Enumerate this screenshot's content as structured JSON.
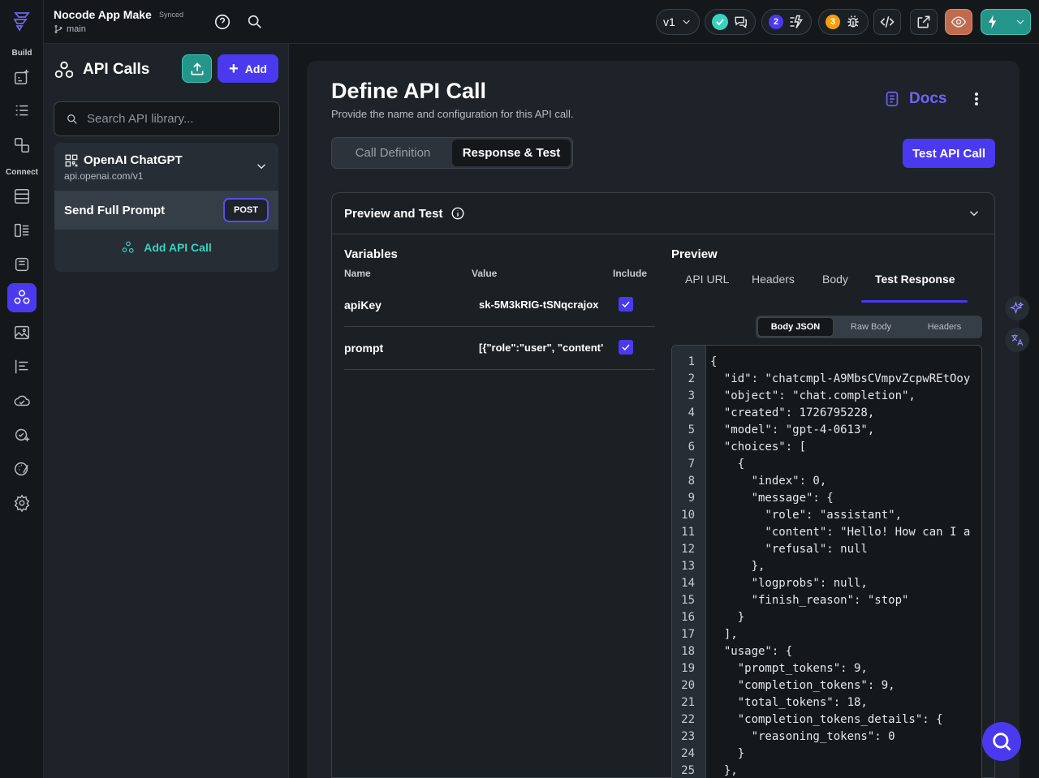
{
  "project": {
    "name": "Nocode App Make",
    "sync_status": "Synced",
    "branch": "main"
  },
  "topbar": {
    "version": "v1",
    "notifications": {
      "warnings_count": "2",
      "bugs_count": "3"
    },
    "colors": {
      "accent": "#4b39ef",
      "success": "#39d2c0",
      "warning": "#f59e0b"
    }
  },
  "rail": {
    "build_label": "Build",
    "connect_label": "Connect"
  },
  "api_panel": {
    "title": "API Calls",
    "add_label": "Add",
    "search_placeholder": "Search API library...",
    "group": {
      "name": "OpenAI ChatGPT",
      "base_url": "api.openai.com/v1"
    },
    "calls": [
      {
        "name": "Send Full Prompt",
        "method": "POST"
      }
    ],
    "add_call_label": "Add API Call"
  },
  "main": {
    "title": "Define API Call",
    "subtitle": "Provide the name and configuration for this API call.",
    "docs_label": "Docs",
    "tabs": [
      "Call Definition",
      "Response & Test"
    ],
    "active_tab": "Response & Test",
    "test_button": "Test API Call",
    "section_title": "Preview and Test"
  },
  "variables": {
    "title": "Variables",
    "columns": [
      "Name",
      "Value",
      "Include"
    ],
    "rows": [
      {
        "name": "apiKey",
        "value": "sk-5M3kRIG-tSNqcrajox",
        "include": true
      },
      {
        "name": "prompt",
        "value": "[{\"role\":\"user\", \"content\"",
        "include": true
      }
    ]
  },
  "preview": {
    "title": "Preview",
    "tabs": [
      "API URL",
      "Headers",
      "Body",
      "Test Response"
    ],
    "active_tab": "Test Response",
    "sub_tabs": [
      "Body JSON",
      "Raw Body",
      "Headers"
    ],
    "active_sub_tab": "Body JSON",
    "code_lines": [
      "{",
      "  \"id\": \"chatcmpl-A9MbsCVmpvZcpwREtOoy",
      "  \"object\": \"chat.completion\",",
      "  \"created\": 1726795228,",
      "  \"model\": \"gpt-4-0613\",",
      "  \"choices\": [",
      "    {",
      "      \"index\": 0,",
      "      \"message\": {",
      "        \"role\": \"assistant\",",
      "        \"content\": \"Hello! How can I a",
      "        \"refusal\": null",
      "      },",
      "      \"logprobs\": null,",
      "      \"finish_reason\": \"stop\"",
      "    }",
      "  ],",
      "  \"usage\": {",
      "    \"prompt_tokens\": 9,",
      "    \"completion_tokens\": 9,",
      "    \"total_tokens\": 18,",
      "    \"completion_tokens_details\": {",
      "      \"reasoning_tokens\": 0",
      "    }",
      "  },"
    ]
  }
}
